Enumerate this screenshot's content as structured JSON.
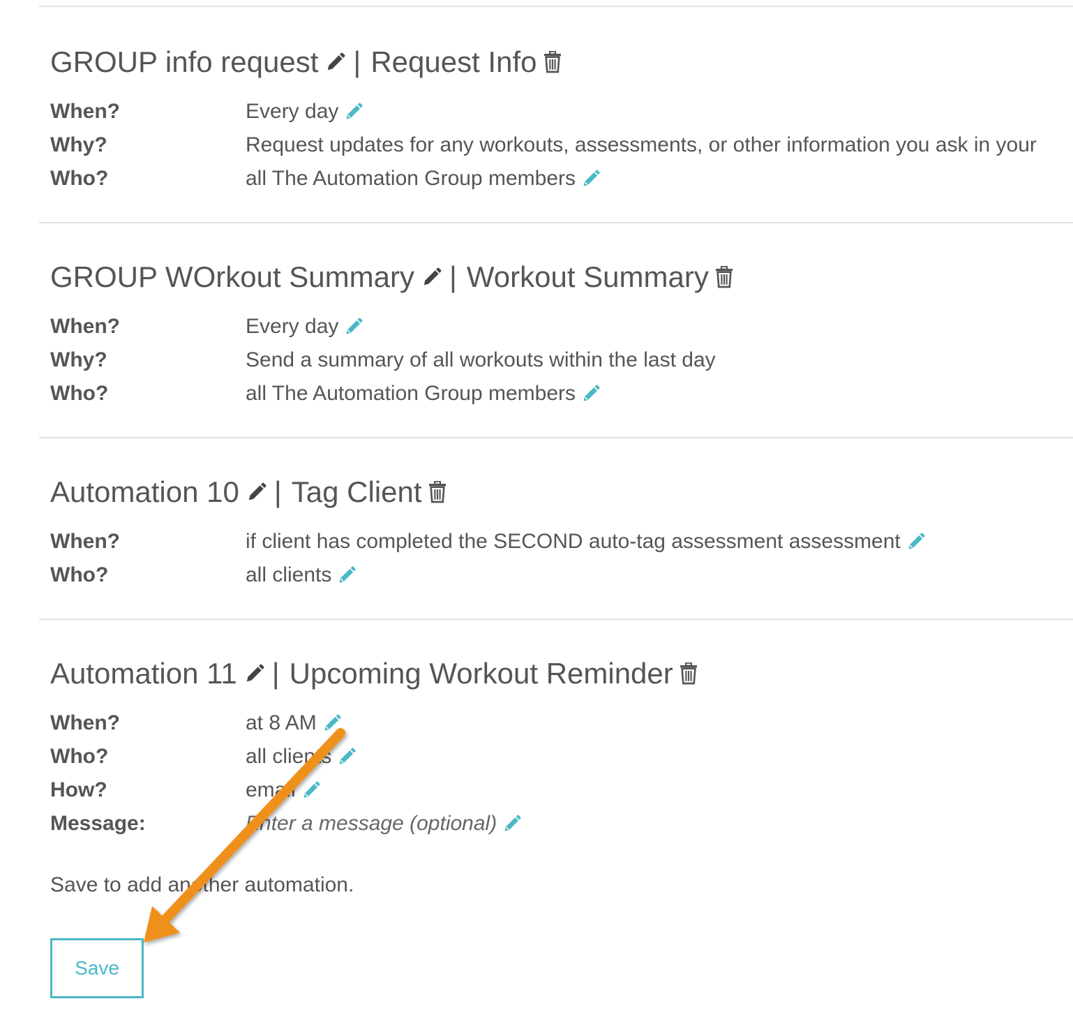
{
  "automations": [
    {
      "name": "GROUP info request",
      "type": "Request Info",
      "rows": [
        {
          "label": "When?",
          "value": "Every day",
          "editable": true
        },
        {
          "label": "Why?",
          "value": "Request updates for any workouts, assessments, or other information you ask in your",
          "editable": false
        },
        {
          "label": "Who?",
          "value": "all The Automation Group members",
          "editable": true
        }
      ]
    },
    {
      "name": "GROUP WOrkout Summary",
      "type": "Workout Summary",
      "rows": [
        {
          "label": "When?",
          "value": "Every day",
          "editable": true
        },
        {
          "label": "Why?",
          "value": "Send a summary of all workouts within the last day",
          "editable": false
        },
        {
          "label": "Who?",
          "value": "all The Automation Group members",
          "editable": true
        }
      ]
    },
    {
      "name": "Automation 10",
      "type": "Tag Client",
      "rows": [
        {
          "label": "When?",
          "value": "if client has completed the SECOND auto-tag assessment assessment",
          "editable": true
        },
        {
          "label": "Who?",
          "value": "all clients",
          "editable": true
        }
      ]
    },
    {
      "name": "Automation 11",
      "type": "Upcoming Workout Reminder",
      "rows": [
        {
          "label": "When?",
          "value": "at 8 AM",
          "editable": true
        },
        {
          "label": "Who?",
          "value": "all clients",
          "editable": true
        },
        {
          "label": "How?",
          "value": "email",
          "editable": true
        },
        {
          "label": "Message:",
          "placeholder": "Enter a message (optional)",
          "editable": true
        }
      ]
    }
  ],
  "separator": "|",
  "footer_note": "Save to add another automation.",
  "save_label": "Save",
  "icons": {
    "title_edit": "pencil-icon",
    "delete": "trash-icon",
    "row_edit": "pencil-icon"
  },
  "colors": {
    "accent": "#4bb8c6",
    "text": "#555555",
    "divider": "#e3e3e3",
    "annotation_arrow": "#f0901a"
  }
}
